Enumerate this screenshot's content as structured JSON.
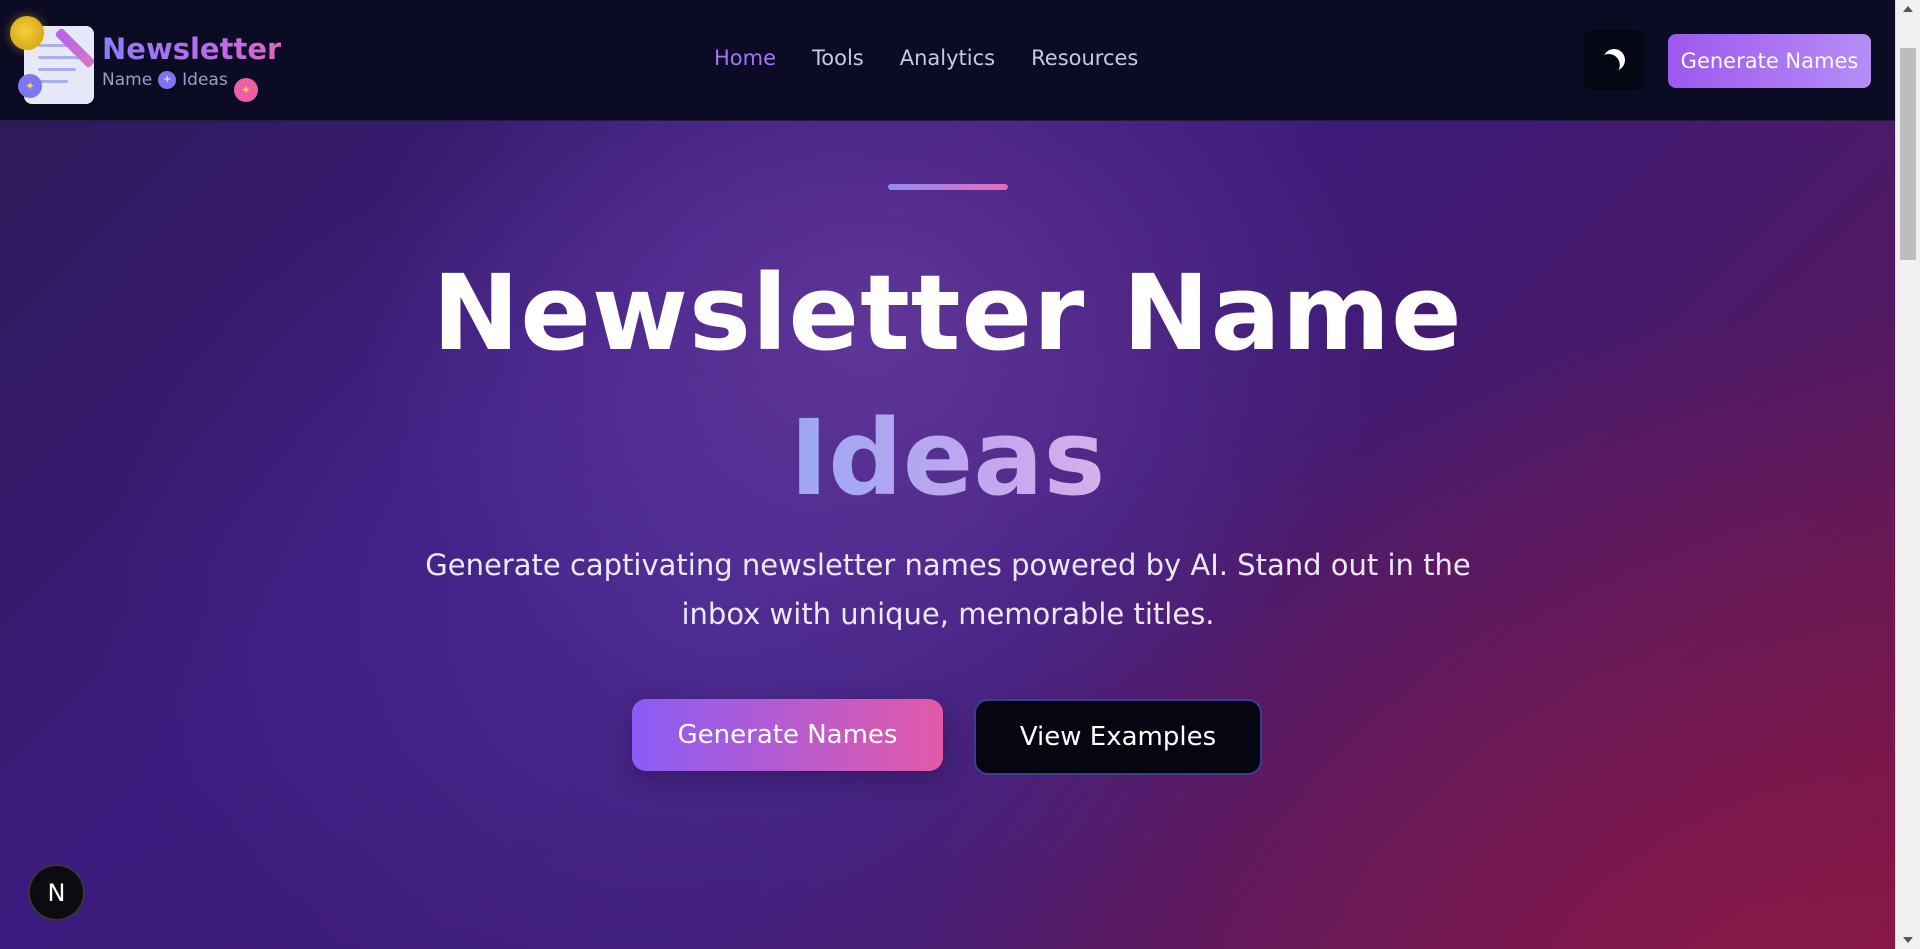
{
  "nav": {
    "brand_title": "Newsletter",
    "brand_sub_left": "Name",
    "brand_sub_right": "Ideas",
    "links": [
      {
        "label": "Home",
        "active": true
      },
      {
        "label": "Tools",
        "active": false
      },
      {
        "label": "Analytics",
        "active": false
      },
      {
        "label": "Resources",
        "active": false
      }
    ],
    "theme_toggle_icon": "moon-icon",
    "cta_label": "Generate Names"
  },
  "hero": {
    "title_line1": "Newsletter Name",
    "title_line2": "Ideas",
    "description": "Generate captivating newsletter names powered by AI. Stand out in the inbox with unique, memorable titles.",
    "primary_button": "Generate Names",
    "secondary_button": "View Examples"
  },
  "badge": {
    "letter": "N"
  },
  "colors": {
    "accent_purple": "#a574f2",
    "accent_pink": "#e25aa8",
    "nav_bg": "#0b0b26"
  }
}
